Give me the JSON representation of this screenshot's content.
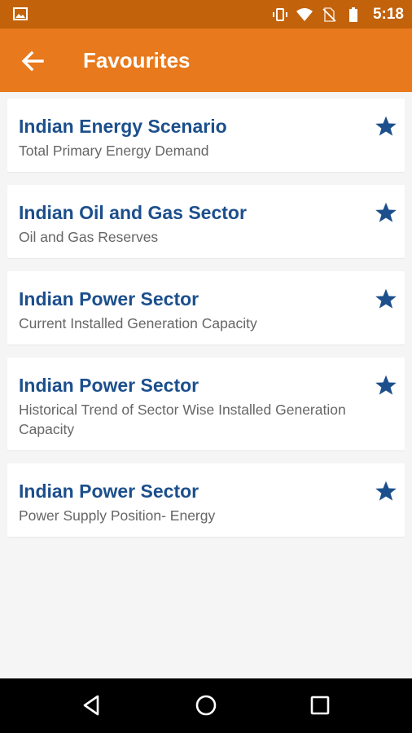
{
  "status_bar": {
    "time": "5:18",
    "icons": [
      "image-icon",
      "vibrate-icon",
      "wifi-icon",
      "no-sim-icon",
      "battery-icon"
    ]
  },
  "app_bar": {
    "title": "Favourites",
    "back_icon": "arrow-back-icon"
  },
  "favourites": [
    {
      "title": "Indian Energy Scenario",
      "subtitle": "Total Primary Energy Demand",
      "icon": "star-icon"
    },
    {
      "title": "Indian Oil and Gas Sector",
      "subtitle": "Oil and Gas Reserves",
      "icon": "star-icon"
    },
    {
      "title": "Indian Power Sector",
      "subtitle": "Current Installed Generation Capacity",
      "icon": "star-icon"
    },
    {
      "title": "Indian Power Sector",
      "subtitle": "Historical Trend of Sector Wise Installed Generation Capacity",
      "icon": "star-icon"
    },
    {
      "title": "Indian Power Sector",
      "subtitle": "Power Supply Position- Energy",
      "icon": "star-icon"
    }
  ],
  "nav_bar": {
    "icons": [
      "back-triangle-icon",
      "home-circle-icon",
      "recents-square-icon"
    ]
  },
  "colors": {
    "status_bar": "#c2620a",
    "app_bar": "#e8791c",
    "title_text": "#1c4f8c",
    "star": "#1c4f8c",
    "background": "#f5f5f5"
  }
}
